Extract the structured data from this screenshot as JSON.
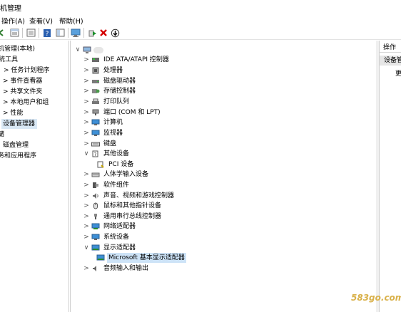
{
  "window": {
    "title": "机管理"
  },
  "menubar": {
    "items": [
      "操作(A)",
      "查看(V)",
      "帮助(H)"
    ]
  },
  "toolbar": {
    "buttons": [
      "back-icon",
      "forward-icon",
      "folder-icon",
      "properties-icon",
      "console-tree-icon",
      "help-icon",
      "view-icon",
      "monitor-icon",
      "enable-device-icon",
      "uninstall-icon",
      "update-driver-icon"
    ],
    "colors": {
      "uninstall": "#d40000",
      "enable": "#1a8f2a",
      "help": "#2a5fb0"
    }
  },
  "left_tree": {
    "items": [
      {
        "label": "机管理(本地)"
      },
      {
        "label": "统工具"
      },
      {
        "label": "任务计划程序"
      },
      {
        "label": "事件查看器"
      },
      {
        "label": "共享文件夹"
      },
      {
        "label": "本地用户和组"
      },
      {
        "label": "性能"
      },
      {
        "label": "设备管理器"
      },
      {
        "label": "储"
      },
      {
        "label": "磁盘管理"
      },
      {
        "label": "务和应用程序"
      }
    ]
  },
  "device_tree": {
    "root_icon": "computer-icon",
    "items": [
      {
        "label": "IDE ATA/ATAPI 控制器",
        "icon": "ide-controller-icon",
        "state": "collapsed"
      },
      {
        "label": "处理器",
        "icon": "processor-icon",
        "state": "collapsed"
      },
      {
        "label": "磁盘驱动器",
        "icon": "disk-drive-icon",
        "state": "collapsed"
      },
      {
        "label": "存储控制器",
        "icon": "storage-controller-icon",
        "state": "collapsed"
      },
      {
        "label": "打印队列",
        "icon": "printer-icon",
        "state": "collapsed"
      },
      {
        "label": "端口 (COM 和 LPT)",
        "icon": "port-icon",
        "state": "collapsed"
      },
      {
        "label": "计算机",
        "icon": "computer-icon",
        "state": "collapsed"
      },
      {
        "label": "监视器",
        "icon": "monitor-icon",
        "state": "collapsed"
      },
      {
        "label": "键盘",
        "icon": "keyboard-icon",
        "state": "collapsed"
      },
      {
        "label": "其他设备",
        "icon": "other-devices-icon",
        "state": "expanded"
      },
      {
        "label": "PCI 设备",
        "icon": "unknown-device-icon",
        "state": "child"
      },
      {
        "label": "人体学输入设备",
        "icon": "hid-icon",
        "state": "collapsed"
      },
      {
        "label": "软件组件",
        "icon": "software-component-icon",
        "state": "collapsed"
      },
      {
        "label": "声音、视频和游戏控制器",
        "icon": "sound-icon",
        "state": "collapsed"
      },
      {
        "label": "鼠标和其他指针设备",
        "icon": "mouse-icon",
        "state": "collapsed"
      },
      {
        "label": "通用串行总线控制器",
        "icon": "usb-icon",
        "state": "collapsed"
      },
      {
        "label": "网络适配器",
        "icon": "network-adapter-icon",
        "state": "collapsed"
      },
      {
        "label": "系统设备",
        "icon": "system-devices-icon",
        "state": "collapsed"
      },
      {
        "label": "显示适配器",
        "icon": "display-adapter-icon",
        "state": "expanded"
      },
      {
        "label": "Microsoft 基本显示适配器",
        "icon": "display-adapter-icon",
        "state": "child-selected"
      },
      {
        "label": "音频输入和输出",
        "icon": "audio-io-icon",
        "state": "collapsed"
      }
    ]
  },
  "actions_pane": {
    "header": "操作",
    "section": "设备管",
    "more": "更"
  },
  "watermark": "583go.com"
}
